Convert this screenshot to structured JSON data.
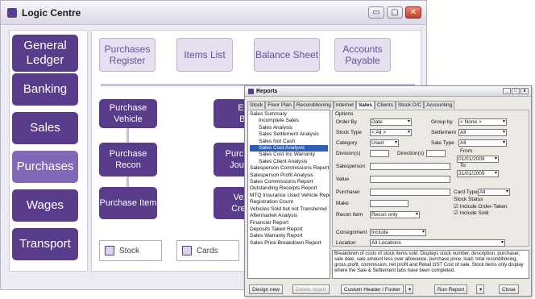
{
  "window": {
    "title": "Logic Centre",
    "min": "▭",
    "max": "▢",
    "close": "✕"
  },
  "left_nav": [
    "General Ledger",
    "Banking",
    "Sales",
    "Purchases",
    "Wages",
    "Transport"
  ],
  "top_buttons": [
    "Purchases Register",
    "Items List",
    "Balance Sheet",
    "Accounts Payable"
  ],
  "purch_buttons": [
    "Purchase Vehicle",
    "Purchase Recon",
    "Purchase Item"
  ],
  "partial_buttons": [
    "En Bi",
    "Purch Jou",
    "Veh Cred"
  ],
  "bottom_buttons": [
    "Stock",
    "Cards"
  ],
  "reports": {
    "title": "Reports",
    "tabs": [
      "Stock",
      "Floor Plan",
      "Reconditioning",
      "Internet",
      "Sales",
      "Clients",
      "Stock D/C",
      "Accounting"
    ],
    "active_tab": "Sales",
    "tree": [
      {
        "label": "Sales Summary",
        "level": 0
      },
      {
        "label": "Incomplete Sales",
        "level": 1
      },
      {
        "label": "Sales Analysis",
        "level": 1
      },
      {
        "label": "Sales Settlement Analysis",
        "level": 1
      },
      {
        "label": "Sales Not Cash",
        "level": 1
      },
      {
        "label": "Sales Cost Analysis",
        "level": 1,
        "selected": true
      },
      {
        "label": "Sales Cost Inc Warranty",
        "level": 1
      },
      {
        "label": "Sales Client Analysis",
        "level": 1
      },
      {
        "label": "Salesperson Commissions Report",
        "level": 0
      },
      {
        "label": "Salesperson Profit Analysis",
        "level": 0
      },
      {
        "label": "Sales Commissions Report",
        "level": 0
      },
      {
        "label": "Outstanding Receipts Report",
        "level": 0
      },
      {
        "label": "MTQ Insurance Used Vehicle Report",
        "level": 0
      },
      {
        "label": "Registration Count",
        "level": 0
      },
      {
        "label": "Vehicles Sold but not Transferred",
        "level": 0
      },
      {
        "label": "Aftermarket Analysis",
        "level": 0
      },
      {
        "label": "Financier Report",
        "level": 0
      },
      {
        "label": "Deposits Taken Report",
        "level": 0
      },
      {
        "label": "Sales Warranty Report",
        "level": 0
      },
      {
        "label": "Sales Price Breakdown Report",
        "level": 0
      }
    ],
    "options": {
      "group_label": "Options",
      "order_by_label": "Order By",
      "order_by": "Date",
      "group_by_label": "Group by",
      "group_by": "< None >",
      "stock_type_label": "Stock Type",
      "stock_type": "< All >",
      "settlement_label": "Settlement",
      "settlement": "All",
      "category_label": "Category",
      "category": "Used",
      "sale_type_label": "Sale Type",
      "sale_type": "All",
      "division_label": "Division(s)",
      "direction_label": "Direction(s)",
      "from_label": "From",
      "from_date": "01/01/2009",
      "to_label": "To",
      "to_date": "31/01/2009",
      "salesperson_label": "Salesperson",
      "value_label": "Value",
      "purchaser_label": "Purchaser",
      "card_type_label": "Card Type",
      "card_type": "All",
      "make_label": "Make",
      "stock_status_label": "Stock Status",
      "order_taken_label": "Include Order-Taken",
      "include_sold_label": "Include Sold",
      "recon_label": "Recon Item",
      "recon": "Recon only",
      "consignment_label": "Consignment",
      "consignment": "Include",
      "location_label": "Location",
      "location": "All Locations"
    },
    "description": "Breakdown of costs of stock items sold. Displays stock number, description, purchaser, sale date, sale amount less over allowance, purchase price, load, total reconditioning, gross profit, commission, net profit and Retail GST Cost of sale. Stock items only display where the Sale & Settlement tabs have been completed.",
    "footer": {
      "design_new": "Design new",
      "delete_report": "Delete report",
      "custom": "Custom Header / Footer",
      "run": "Run Report",
      "close": "Close"
    }
  }
}
